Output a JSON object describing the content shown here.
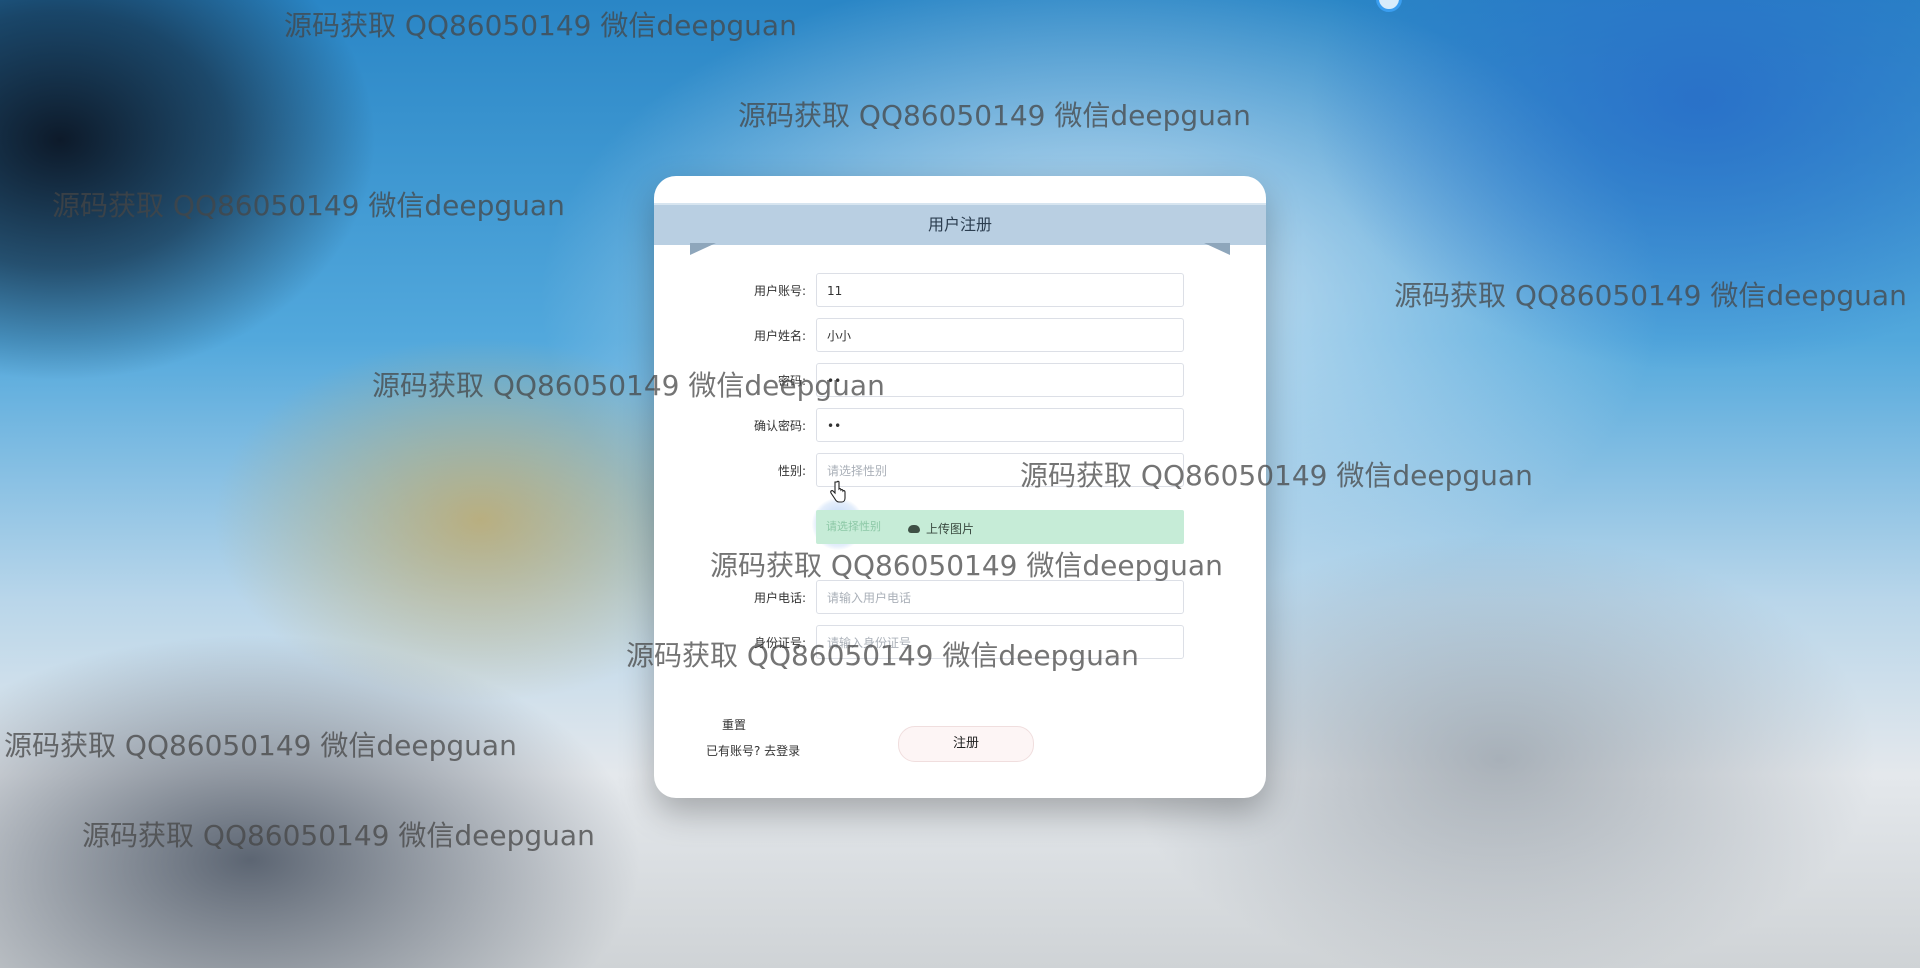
{
  "form": {
    "title": "用户注册",
    "fields": [
      {
        "label": "用户账号:",
        "value": "11"
      },
      {
        "label": "用户姓名:",
        "value": "小小"
      },
      {
        "label": "密码:",
        "value": "••"
      },
      {
        "label": "确认密码:",
        "value": "••"
      },
      {
        "label": "性别:",
        "placeholder": "请选择性别"
      },
      {
        "label": "用户电话:",
        "placeholder": "请输入用户电话"
      },
      {
        "label": "身份证号:",
        "placeholder": "请输入身份证号"
      }
    ],
    "upload": {
      "hint": "请选择性别",
      "button": "上传图片"
    },
    "reset": "重置",
    "login_link": "已有账号? 去登录",
    "submit": "注册"
  },
  "watermark": "源码获取 QQ86050149 微信deepguan",
  "colors": {
    "ribbon": "#b9cfe2",
    "upload_bg": "#c6ecd7",
    "submit_bg": "#fdf5f5"
  }
}
